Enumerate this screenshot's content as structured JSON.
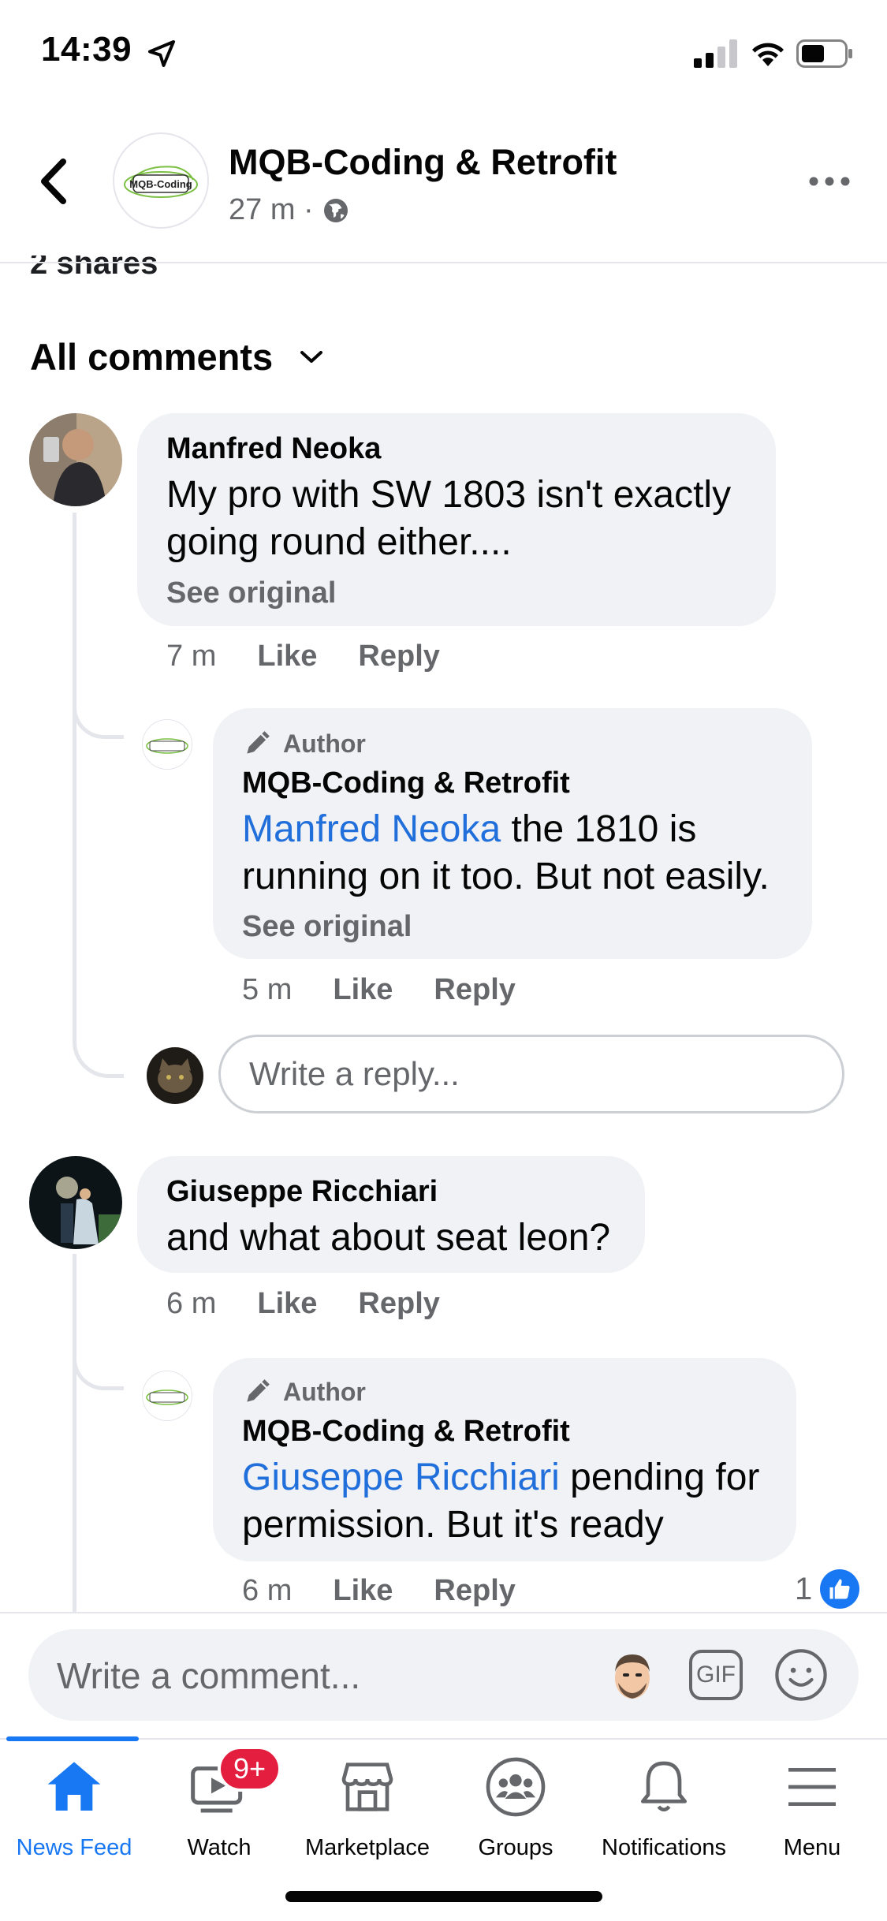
{
  "status": {
    "time": "14:39"
  },
  "header": {
    "page_name": "MQB-Coding & Retrofit",
    "avatar_logo_text": "MQB-Coding",
    "time": "27 m ·"
  },
  "shares_text": "2 shares",
  "comments_filter": "All comments",
  "comments": [
    {
      "author": "Manfred Neoka",
      "text": "My pro with SW 1803 isn't exactly going round either....",
      "line1": "My pro with SW 1803 isn't exactly",
      "line2": "going round either....",
      "see_original": "See original",
      "time": "7 m",
      "like": "Like",
      "reply": "Reply",
      "replies": [
        {
          "tag": "Author",
          "author": "MQB-Coding & Retrofit",
          "mention": "Manfred Neoka",
          "line1_rest": " the 1810 is",
          "line2": "running on it too. But not easily.",
          "see_original": "See original",
          "time": "5 m",
          "like": "Like",
          "reply": "Reply"
        }
      ],
      "reply_placeholder": "Write a reply..."
    },
    {
      "author": "Giuseppe Ricchiari",
      "text": "and what about seat leon?",
      "time": "6 m",
      "like": "Like",
      "reply": "Reply",
      "replies": [
        {
          "tag": "Author",
          "author": "MQB-Coding & Retrofit",
          "mention": "Giuseppe Ricchiari",
          "line1_rest": " pending for",
          "line2": "permission. But it's ready",
          "time": "6 m",
          "like": "Like",
          "reply": "Reply",
          "reaction_count": "1"
        }
      ]
    }
  ],
  "composer": {
    "placeholder": "Write a comment...",
    "gif_label": "GIF"
  },
  "tabs": [
    {
      "label": "News Feed",
      "icon": "home-icon",
      "active": true
    },
    {
      "label": "Watch",
      "icon": "watch-icon",
      "badge": "9+"
    },
    {
      "label": "Marketplace",
      "icon": "marketplace-icon"
    },
    {
      "label": "Groups",
      "icon": "groups-icon"
    },
    {
      "label": "Notifications",
      "icon": "bell-icon"
    },
    {
      "label": "Menu",
      "icon": "menu-icon"
    }
  ],
  "colors": {
    "accent": "#1877f2",
    "mention": "#216fdb",
    "bubble": "#f0f2f5",
    "muted": "#65676b",
    "badge": "#e41e3f"
  }
}
